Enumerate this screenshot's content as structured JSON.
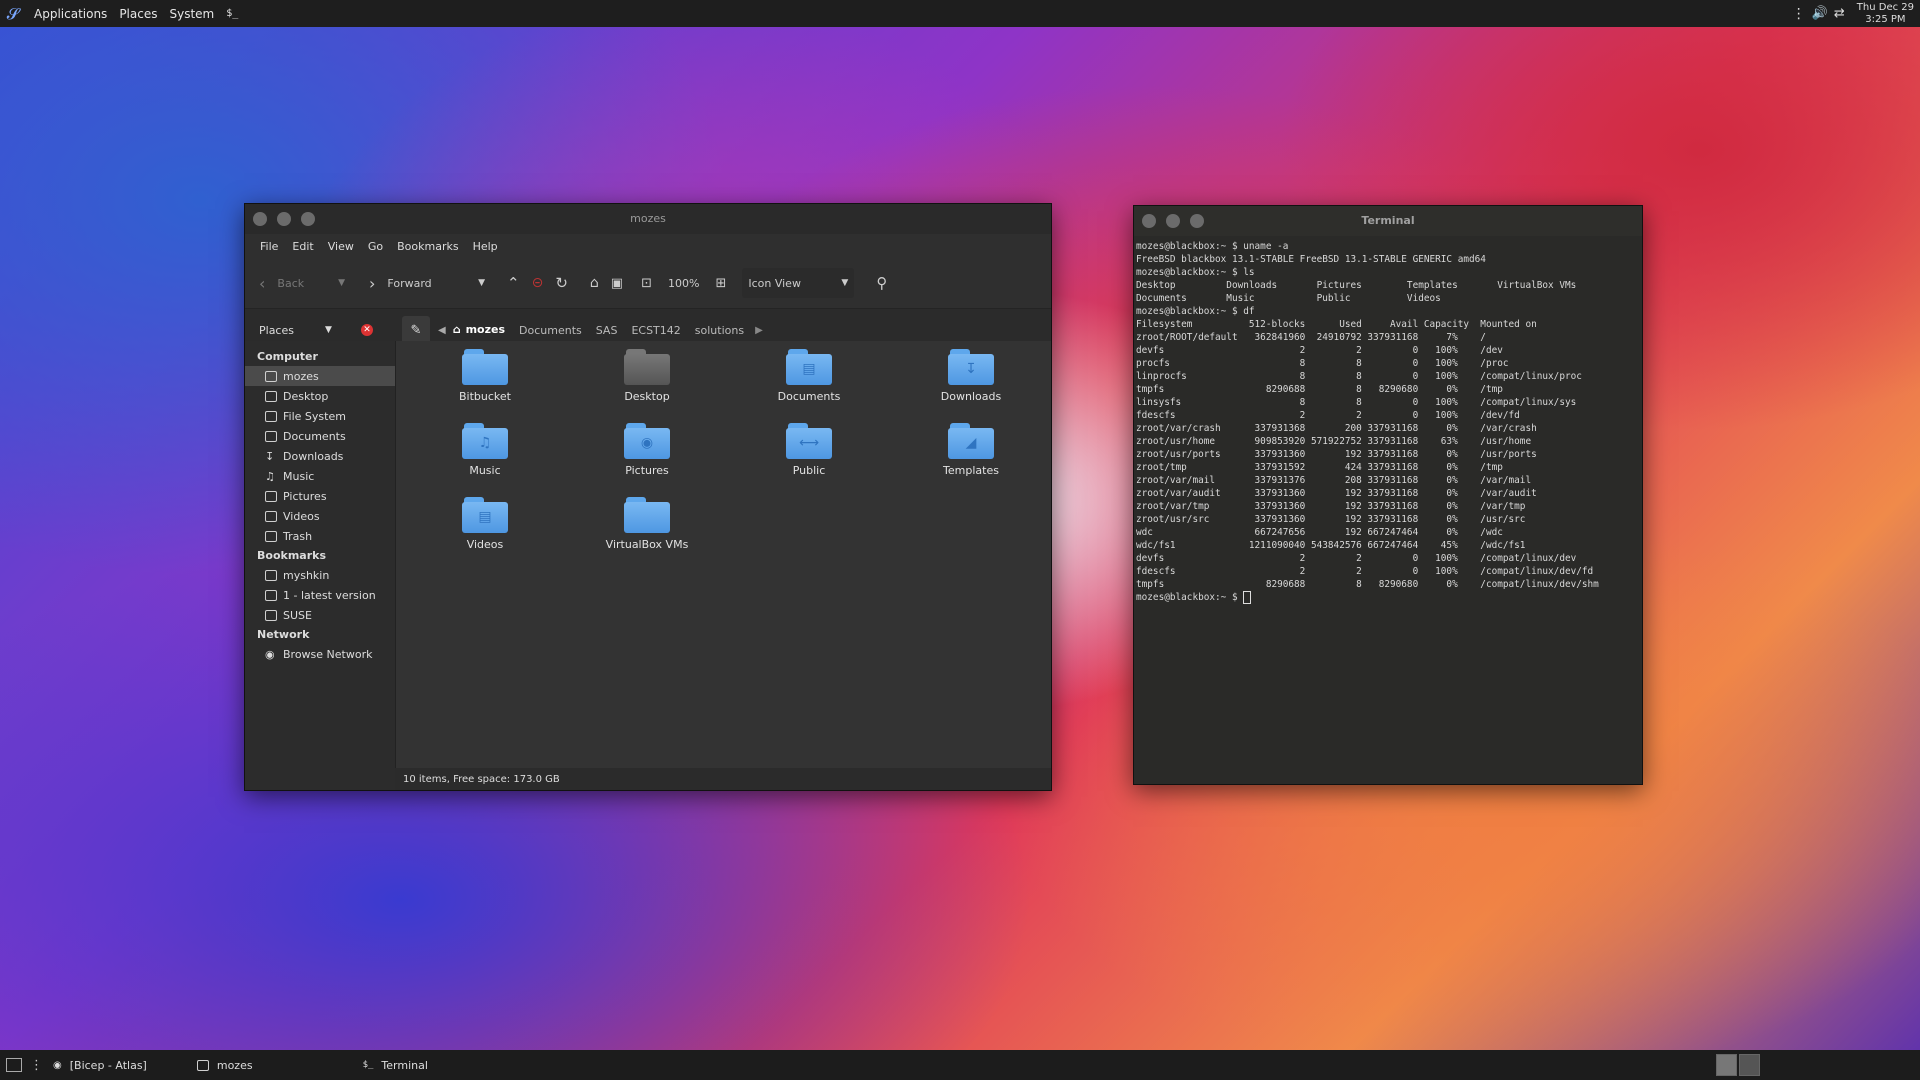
{
  "top_panel": {
    "menus": [
      "Applications",
      "Places",
      "System"
    ],
    "terminal_launcher": "$_",
    "clock_date": "Thu Dec 29",
    "clock_time": "3:25 PM"
  },
  "file_manager": {
    "title": "mozes",
    "menu": [
      "File",
      "Edit",
      "View",
      "Go",
      "Bookmarks",
      "Help"
    ],
    "toolbar": {
      "back": "Back",
      "forward": "Forward",
      "zoom": "100%",
      "view_mode": "Icon View"
    },
    "places_label": "Places",
    "breadcrumbs": [
      "mozes",
      "Documents",
      "SAS",
      "ECST142",
      "solutions"
    ],
    "sidebar": {
      "computer_heading": "Computer",
      "computer": [
        "mozes",
        "Desktop",
        "File System",
        "Documents",
        "Downloads",
        "Music",
        "Pictures",
        "Videos",
        "Trash"
      ],
      "bookmarks_heading": "Bookmarks",
      "bookmarks": [
        "myshkin",
        "1 - latest version",
        "SUSE"
      ],
      "network_heading": "Network",
      "network": [
        "Browse Network"
      ]
    },
    "items": [
      "Bitbucket",
      "Desktop",
      "Documents",
      "Downloads",
      "Music",
      "Pictures",
      "Public",
      "Templates",
      "Videos",
      "VirtualBox VMs"
    ],
    "status": "10 items, Free space: 173.0 GB"
  },
  "terminal": {
    "title": "Terminal",
    "lines": [
      "mozes@blackbox:~ $ uname -a",
      "FreeBSD blackbox 13.1-STABLE FreeBSD 13.1-STABLE GENERIC amd64",
      "mozes@blackbox:~ $ ls",
      "Desktop         Downloads       Pictures        Templates       VirtualBox VMs",
      "Documents       Music           Public          Videos",
      "mozes@blackbox:~ $ df",
      "Filesystem          512-blocks      Used     Avail Capacity  Mounted on",
      "zroot/ROOT/default   362841960  24910792 337931168     7%    /",
      "devfs                        2         2         0   100%    /dev",
      "procfs                       8         8         0   100%    /proc",
      "linprocfs                    8         8         0   100%    /compat/linux/proc",
      "tmpfs                  8290688         8   8290680     0%    /tmp",
      "linsysfs                     8         8         0   100%    /compat/linux/sys",
      "fdescfs                      2         2         0   100%    /dev/fd",
      "zroot/var/crash      337931368       200 337931168     0%    /var/crash",
      "zroot/usr/home       909853920 571922752 337931168    63%    /usr/home",
      "zroot/usr/ports      337931360       192 337931168     0%    /usr/ports",
      "zroot/tmp            337931592       424 337931168     0%    /tmp",
      "zroot/var/mail       337931376       208 337931168     0%    /var/mail",
      "zroot/var/audit      337931360       192 337931168     0%    /var/audit",
      "zroot/var/tmp        337931360       192 337931168     0%    /var/tmp",
      "zroot/usr/src        337931360       192 337931168     0%    /usr/src",
      "wdc                  667247656       192 667247464     0%    /wdc",
      "wdc/fs1             1211090040 543842576 667247464    45%    /wdc/fs1",
      "devfs                        2         2         0   100%    /compat/linux/dev",
      "fdescfs                      2         2         0   100%    /compat/linux/dev/fd",
      "tmpfs                  8290688         8   8290680     0%    /compat/linux/dev/shm"
    ],
    "prompt": "mozes@blackbox:~ $ "
  },
  "taskbar": {
    "tasks": [
      "[Bicep - Atlas]",
      "mozes",
      "Terminal"
    ]
  }
}
